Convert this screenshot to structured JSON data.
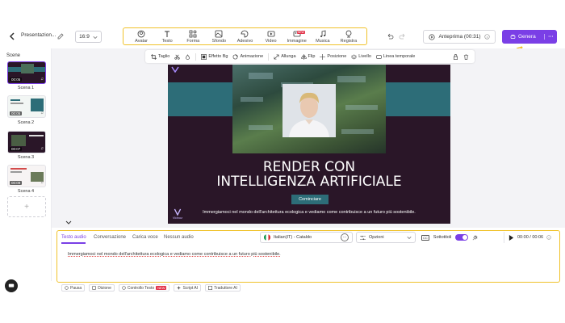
{
  "header": {
    "project_name": "Presentazion...",
    "ratio": "16:9",
    "preview_label": "Anteprima (00:31)",
    "generate_label": "Genera",
    "more_label": "···"
  },
  "tools": [
    {
      "label": "Avatar",
      "icon": "avatar-icon"
    },
    {
      "label": "Testo",
      "icon": "text-icon"
    },
    {
      "label": "Forma",
      "icon": "shape-icon"
    },
    {
      "label": "Sfondo",
      "icon": "background-icon"
    },
    {
      "label": "Adesivo",
      "icon": "sticker-icon"
    },
    {
      "label": "Video",
      "icon": "video-icon"
    },
    {
      "label": "Immagine",
      "icon": "image-icon",
      "badge": "NEW"
    },
    {
      "label": "Musica",
      "icon": "music-icon"
    },
    {
      "label": "Registra",
      "icon": "record-icon"
    }
  ],
  "sidebar": {
    "title": "Scene",
    "scenes": [
      {
        "label": "Scena 1",
        "duration": "00:05"
      },
      {
        "label": "Scena 2",
        "duration": "00:05"
      },
      {
        "label": "Scena 3",
        "duration": "00:07"
      },
      {
        "label": "Scena 4",
        "duration": "00:09"
      }
    ],
    "add_symbol": "+"
  },
  "edit_toolbar": {
    "crop": "Taglio",
    "effects": "Effetto Bg",
    "animation": "Animazione",
    "stretch": "Allunga",
    "flip": "Flip",
    "position": "Posizione",
    "layer": "Livello",
    "timeline": "Linea temporale"
  },
  "canvas": {
    "headline_line1": "RENDER CON",
    "headline_line2": "INTELLIGENZA ARTIFICIALE",
    "cta": "Cominciare",
    "subtitle": "Immergiamoci nel mondo dell'architettura ecologica e vediamo come contribuisce a un futuro più sostenibile.",
    "watermark": "Vidnoz"
  },
  "bottom": {
    "tabs": [
      "Testo audio",
      "Conversazione",
      "Carica voce",
      "Nessun audio"
    ],
    "active_tab": "Testo audio",
    "voice": "Italian(IT) - Cataldo",
    "options": "Opzioni",
    "subtitles_label": "Sottotitoli",
    "cc": "CC",
    "time": "00:00 / 00:06",
    "script": "Immergiamoci nel mondo dell'architettura ecologica e vediamo come contribuisce a un futuro più sostenibile.",
    "chips": [
      {
        "label": "Pausa"
      },
      {
        "label": "Dizione"
      },
      {
        "label": "Controllo Testo",
        "badge": "NEW"
      },
      {
        "label": "Script AI"
      },
      {
        "label": "Traduttore AI"
      }
    ]
  },
  "colors": {
    "accent": "#7a3fe6",
    "highlight": "#f0c22a",
    "canvas_bg": "#2a1628",
    "teal": "#2d6d78"
  }
}
